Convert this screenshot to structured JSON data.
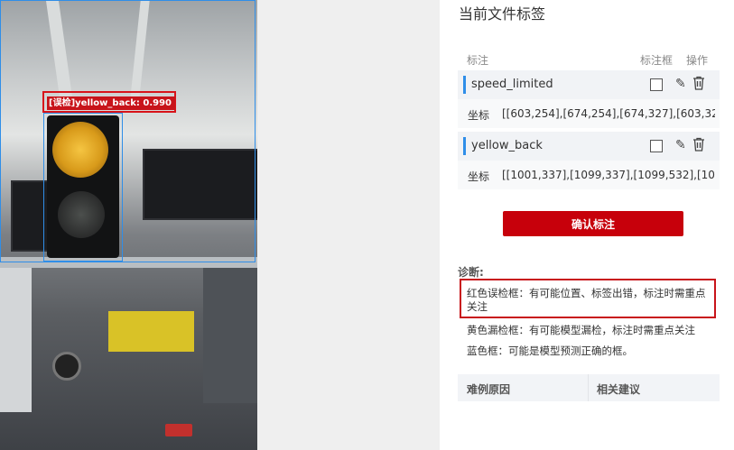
{
  "canvas": {
    "detection_label": "[误检]yellow_back:  0.990"
  },
  "panel": {
    "title": "当前文件标签",
    "headers": {
      "annotation": "标注",
      "box": "标注框",
      "operation": "操作"
    },
    "annotations": [
      {
        "name": "speed_limited",
        "coord_label": "坐标",
        "coords": "[[603,254],[674,254],[674,327],[603,32..."
      },
      {
        "name": "yellow_back",
        "coord_label": "坐标",
        "coords": "[[1001,337],[1099,337],[1099,532],[10..."
      }
    ],
    "confirm_button": "确认标注",
    "diagnosis": {
      "title": "诊断:",
      "red": "红色误检框：有可能位置、标签出错，标注时需重点关注",
      "yellow": "黄色漏检框：有可能模型漏检，标注时需重点关注",
      "blue": "蓝色框：可能是模型预测正确的框。"
    },
    "table": {
      "col1": "难例原因",
      "col2": "相关建议"
    }
  },
  "colors": {
    "accent_red": "#c7000b",
    "box_blue": "#2f8ee8",
    "error_red": "#d8141a"
  },
  "icons": {
    "edit": "pencil-icon",
    "delete": "trash-icon",
    "checkbox": "checkbox-icon"
  }
}
